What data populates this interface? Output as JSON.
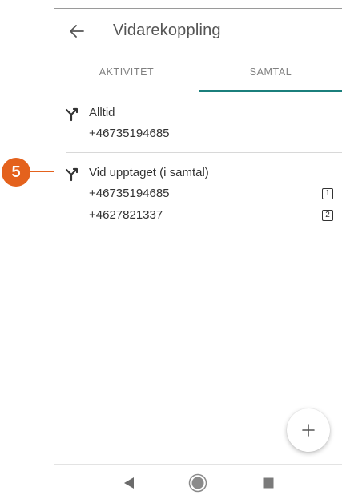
{
  "appbar": {
    "title": "Vidarekoppling",
    "back_icon": "arrow-left-icon"
  },
  "tabs": [
    {
      "label": "AKTIVITET",
      "selected": false
    },
    {
      "label": "SAMTAL",
      "selected": true
    }
  ],
  "rules": [
    {
      "title": "Alltid",
      "icon": "call-forward-icon",
      "numbers": [
        {
          "number": "+46735194685"
        }
      ]
    },
    {
      "title": "Vid upptaget (i samtal)",
      "icon": "call-forward-icon",
      "numbers": [
        {
          "number": "+46735194685",
          "order": "1"
        },
        {
          "number": "+4627821337",
          "order": "2"
        }
      ]
    }
  ],
  "fab": {
    "icon": "plus-icon"
  },
  "navbar": {
    "back": "triangle-back-icon",
    "home": "circle-home-icon",
    "recents": "square-recents-icon"
  },
  "callout": {
    "label": "5"
  },
  "colors": {
    "accent": "#1b7f7c",
    "callout": "#e4621d",
    "text": "#333333",
    "muted": "#808080"
  }
}
